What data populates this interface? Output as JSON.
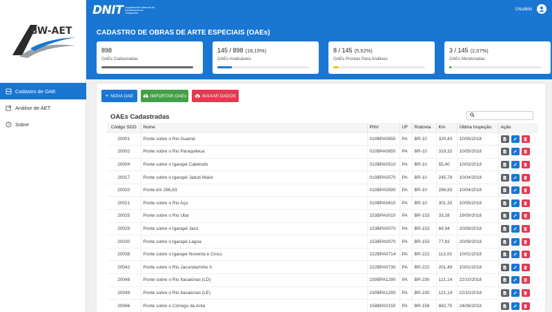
{
  "app": {
    "logo_text": "BW-AET",
    "dnit_word": "DNIT",
    "dnit_sub": "Departamento Nacional de Infraestrutura de Transportes",
    "user_label": "Usuário"
  },
  "sidebar": {
    "items": [
      {
        "label": "Cadastro de OAE",
        "icon": "bridge-icon",
        "active": true
      },
      {
        "label": "Análise de AET",
        "icon": "analysis-icon",
        "active": false
      },
      {
        "label": "Sobre",
        "icon": "help-icon",
        "active": false
      }
    ]
  },
  "page": {
    "title": "CADASTRO DE OBRAS DE ARTE ESPECIAIS (OAEs)"
  },
  "stats": [
    {
      "value": "898",
      "pct": "",
      "label": "OAEs Cadastradas",
      "fraction": 1.0,
      "color": "#666666"
    },
    {
      "value": "145 / 898",
      "pct": "(16,15%)",
      "label": "OAEs Analisáveis",
      "fraction": 0.1615,
      "color": "#1976d2"
    },
    {
      "value": "8 / 145",
      "pct": "(5,52%)",
      "label": "OAEs Prontas Para Análises",
      "fraction": 0.0552,
      "color": "#f4c20d"
    },
    {
      "value": "3 / 145",
      "pct": "(2,07%)",
      "label": "OAEs Monitoradas",
      "fraction": 0.0207,
      "color": "#43a047"
    }
  ],
  "toolbar": {
    "new_label": "NOVA OAE",
    "import_label": "IMPORTAR OAEs",
    "download_label": "BAIXAR DADOS"
  },
  "table": {
    "title": "OAEs Cadastradas",
    "search_placeholder": "",
    "headers": [
      "Código SGO",
      "Nome",
      "PNV",
      "UF",
      "Rodovia",
      "Km",
      "Última Inspeção",
      "Ação"
    ],
    "rows": [
      [
        "20001",
        "Ponte sobre o Rio Guamá",
        "010BPA0650",
        "PA",
        "BR-10",
        "320,43",
        "10/05/2018"
      ],
      [
        "20002",
        "Ponte sobre o Rio Paraquiteua",
        "010BPA0650",
        "PA",
        "BR-10",
        "319,32",
        "10/05/2018"
      ],
      [
        "20004",
        "Ponte sobre o Igarapé Cabeludo",
        "010BPA0510",
        "PA",
        "BR-10",
        "55,40",
        "10/03/2018"
      ],
      [
        "20017",
        "Ponte sobre o Igarapé Jabuti Maior",
        "010BPA0570",
        "PA",
        "BR-10",
        "245,79",
        "10/04/2018"
      ],
      [
        "20020",
        "Ponte km 286,83",
        "010BPA0590",
        "PA",
        "BR-10",
        "286,83",
        "10/04/2018"
      ],
      [
        "20021",
        "Ponte sobre o Rio Açu",
        "010BPA0610",
        "PA",
        "BR-10",
        "301,33",
        "10/05/2018"
      ],
      [
        "20025",
        "Ponte sobre o Rio Ubá",
        "153BPA0010",
        "PA",
        "BR-153",
        "33,28",
        "19/09/2018"
      ],
      [
        "20029",
        "Ponte sobre o Igarapé Jacú",
        "153BPA0070",
        "PA",
        "BR-153",
        "69,94",
        "20/09/2018"
      ],
      [
        "20030",
        "Ponte sobre o Igarapé Lagoa",
        "153BPA0070",
        "PA",
        "BR-153",
        "77,83",
        "20/09/2018"
      ],
      [
        "20038",
        "Ponte sobre o Igarapé Noventa e Cinco",
        "222BPA0714",
        "PA",
        "BR-222",
        "113,03",
        "10/01/2018"
      ],
      [
        "20042",
        "Ponte sobre o Rio Jacundazinho II",
        "222BPA0730",
        "PA",
        "BR-222",
        "201,49",
        "10/01/2018"
      ],
      [
        "20048",
        "Ponte sobre o Rio Itacaiúnas (LD)",
        "230BPA1290",
        "PA",
        "BR-230",
        "121,14",
        "22/10/2018"
      ],
      [
        "20049",
        "Ponte sobre o Rio Itacaiúnas (LE)",
        "230BPA1290",
        "PA",
        "BR-230",
        "121,14",
        "22/10/2018"
      ],
      [
        "20066",
        "Ponte sobre o Córrego da Anta",
        "158BPA0150",
        "PA",
        "BR-158",
        "882,75",
        "24/08/2018"
      ]
    ]
  },
  "colors": {
    "primary": "#1976d2",
    "green": "#43a047",
    "red": "#e53950",
    "gray": "#5f6368"
  }
}
